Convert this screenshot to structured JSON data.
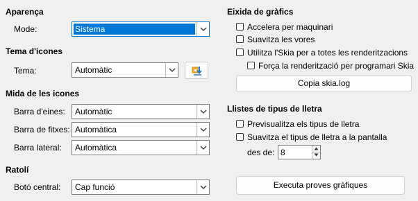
{
  "appearance": {
    "title": "Aparença",
    "mode_label": "Mode:",
    "mode_value": "Sistema"
  },
  "icon_theme": {
    "title": "Tema d'icones",
    "theme_label": "Tema:",
    "theme_value": "Automàtic"
  },
  "icon_size": {
    "title": "Mida de les icones",
    "toolbar_label": "Barra d'eines:",
    "toolbar_value": "Automàtic",
    "tabbar_label": "Barra de fitxes:",
    "tabbar_value": "Automàtica",
    "sidebar_label": "Barra lateral:",
    "sidebar_value": "Automàtica"
  },
  "mouse": {
    "title": "Ratolí",
    "middle_label": "Botó central:",
    "middle_value": "Cap funció"
  },
  "graphics_output": {
    "title": "Eixida de gràfics",
    "hw_accel": "Accelera per maquinari",
    "antialias": "Suavitza les vores",
    "skia_all": "Utilitza l'Skia per a totes les renderitzacions",
    "skia_software": "Força la renderització per programari Skia",
    "copy_skia_log": "Copia skia.log"
  },
  "font_lists": {
    "title": "Llistes de tipus de lletra",
    "preview": "Previsualitza els tipus de lletra",
    "screen_antialias": "Suavitza el tipus de lletra a la pantalla",
    "from_label": "des de:",
    "from_value": "8"
  },
  "run_graphics_tests": "Executa proves gràfiques",
  "icons": {
    "dropdown": "chevron-down-icon",
    "theme_extension": "add-icon-theme-icon",
    "spin_up": "spin-up-icon",
    "spin_down": "spin-down-icon"
  },
  "colors": {
    "selection": "#0078d7",
    "window_bg": "#f0f0f0"
  }
}
